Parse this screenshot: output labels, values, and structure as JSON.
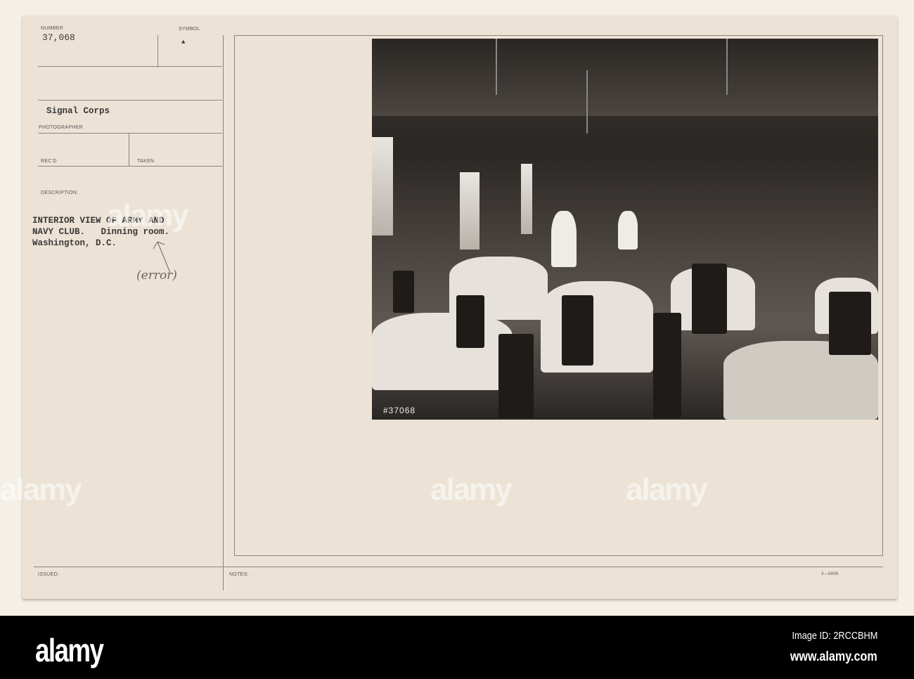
{
  "card": {
    "number_label": "NUMBER",
    "number": "37,068",
    "symbol_label": "SYMBOL",
    "symbol": "▲",
    "photographer": "Signal Corps",
    "photographer_label": "PHOTOGRAPHER",
    "recd_label": "REC'D",
    "taken_label": "TAKEN",
    "description_label": "DESCRIPTION:",
    "description_lines": [
      "INTERIOR VIEW OF ARMY AND",
      "NAVY CLUB.   Dinning room.",
      "Washington, D.C."
    ],
    "handwritten_note": "(error)",
    "issued_label": "ISSUED:",
    "notes_label": "NOTES:",
    "form_number": "3—5606",
    "negative_number": "#37068"
  },
  "footer": {
    "logo": "alamy",
    "image_id": "Image ID: 2RCCBHM",
    "url": "www.alamy.com"
  },
  "watermark": "alamy"
}
